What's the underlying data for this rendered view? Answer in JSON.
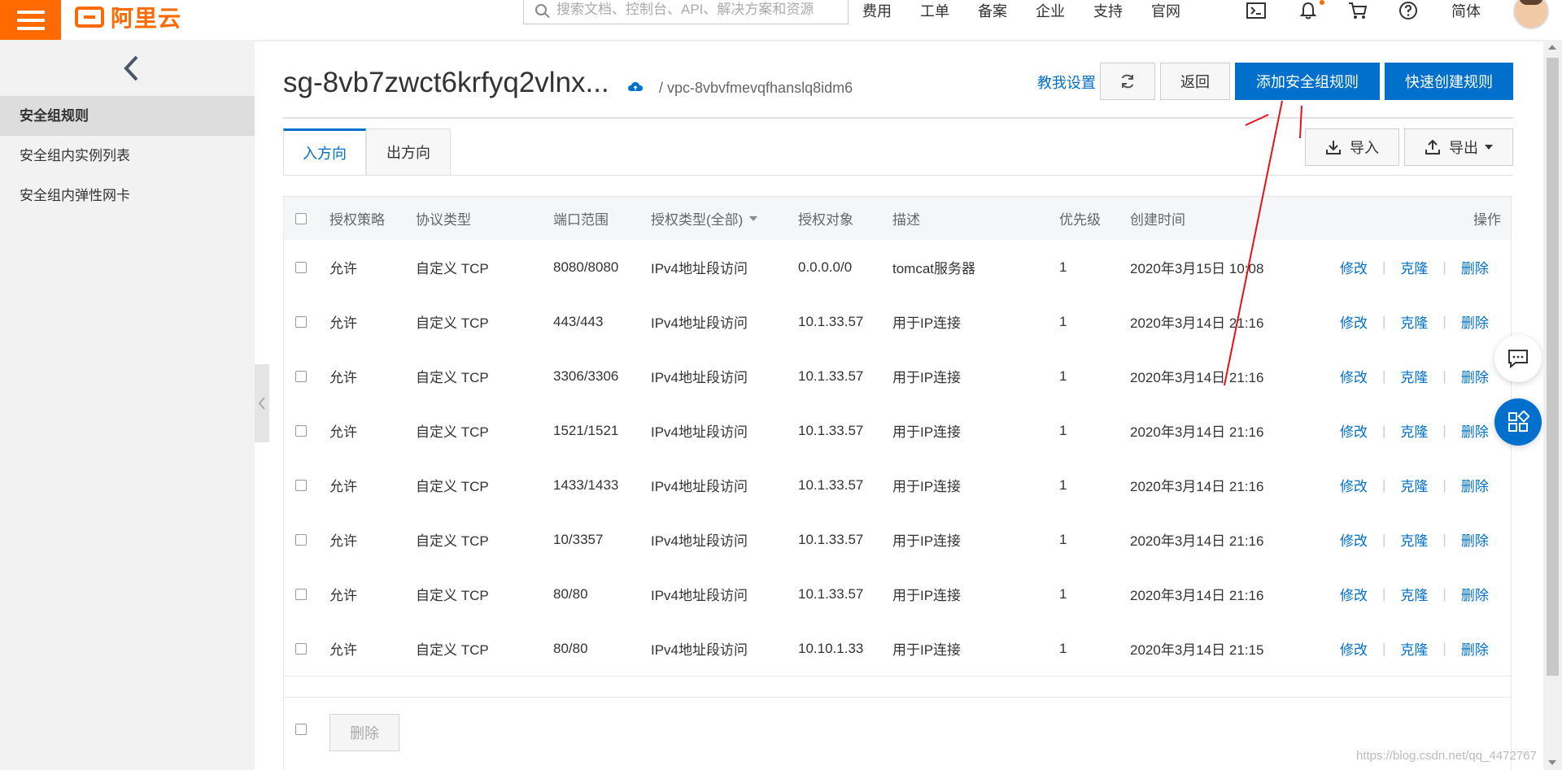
{
  "topbar": {
    "logo_text": "阿里云",
    "search_placeholder": "搜索文档、控制台、API、解决方案和资源",
    "nav_items": [
      "费用",
      "工单",
      "备案",
      "企业",
      "支持",
      "官网"
    ],
    "language": "简体",
    "brand_color": "#ff6a00"
  },
  "sidebar": {
    "items": [
      {
        "label": "安全组规则",
        "active": true
      },
      {
        "label": "安全组内实例列表",
        "active": false
      },
      {
        "label": "安全组内弹性网卡",
        "active": false
      }
    ]
  },
  "header": {
    "title": "sg-8vb7zwct6krfyq2vlnx...",
    "vpc": "/ vpc-8vbvfmevqfhanslq8idm6",
    "guide_link": "教我设置",
    "back_button": "返回",
    "add_rule_button": "添加安全组规则",
    "quick_create_button": "快速创建规则",
    "accent_color": "#0070cc"
  },
  "tabs": [
    {
      "label": "入方向",
      "active": true
    },
    {
      "label": "出方向",
      "active": false
    }
  ],
  "toolbar": {
    "import_label": "导入",
    "export_label": "导出"
  },
  "table": {
    "columns": [
      "授权策略",
      "协议类型",
      "端口范围",
      "授权类型(全部)",
      "授权对象",
      "描述",
      "优先级",
      "创建时间",
      "操作"
    ],
    "actions": [
      "修改",
      "克隆",
      "删除"
    ],
    "rows": [
      {
        "policy": "允许",
        "protocol": "自定义 TCP",
        "port": "8080/8080",
        "auth_type": "IPv4地址段访问",
        "target": "0.0.0.0/0",
        "desc": "tomcat服务器",
        "priority": "1",
        "created": "2020年3月15日 10:08"
      },
      {
        "policy": "允许",
        "protocol": "自定义 TCP",
        "port": "443/443",
        "auth_type": "IPv4地址段访问",
        "target": "10.1.33.57",
        "desc": "用于IP连接",
        "priority": "1",
        "created": "2020年3月14日 21:16"
      },
      {
        "policy": "允许",
        "protocol": "自定义 TCP",
        "port": "3306/3306",
        "auth_type": "IPv4地址段访问",
        "target": "10.1.33.57",
        "desc": "用于IP连接",
        "priority": "1",
        "created": "2020年3月14日 21:16"
      },
      {
        "policy": "允许",
        "protocol": "自定义 TCP",
        "port": "1521/1521",
        "auth_type": "IPv4地址段访问",
        "target": "10.1.33.57",
        "desc": "用于IP连接",
        "priority": "1",
        "created": "2020年3月14日 21:16"
      },
      {
        "policy": "允许",
        "protocol": "自定义 TCP",
        "port": "1433/1433",
        "auth_type": "IPv4地址段访问",
        "target": "10.1.33.57",
        "desc": "用于IP连接",
        "priority": "1",
        "created": "2020年3月14日 21:16"
      },
      {
        "policy": "允许",
        "protocol": "自定义 TCP",
        "port": "10/3357",
        "auth_type": "IPv4地址段访问",
        "target": "10.1.33.57",
        "desc": "用于IP连接",
        "priority": "1",
        "created": "2020年3月14日 21:16"
      },
      {
        "policy": "允许",
        "protocol": "自定义 TCP",
        "port": "80/80",
        "auth_type": "IPv4地址段访问",
        "target": "10.1.33.57",
        "desc": "用于IP连接",
        "priority": "1",
        "created": "2020年3月14日 21:16"
      },
      {
        "policy": "允许",
        "protocol": "自定义 TCP",
        "port": "80/80",
        "auth_type": "IPv4地址段访问",
        "target": "10.10.1.33",
        "desc": "用于IP连接",
        "priority": "1",
        "created": "2020年3月14日 21:15"
      }
    ]
  },
  "footer": {
    "delete_button": "删除"
  },
  "watermark": "https://blog.csdn.net/qq_4472767"
}
